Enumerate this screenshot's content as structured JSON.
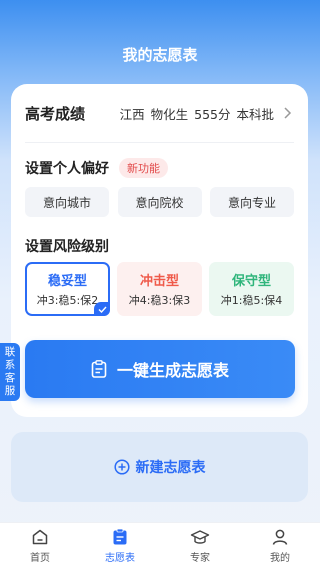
{
  "header": {
    "title": "我的志愿表"
  },
  "score": {
    "title": "高考成绩",
    "province": "江西",
    "subjects": "物化生",
    "points": "555分",
    "batch": "本科批"
  },
  "preferences": {
    "label": "设置个人偏好",
    "badge": "新功能",
    "options": [
      "意向城市",
      "意向院校",
      "意向专业"
    ]
  },
  "risk": {
    "label": "设置风险级别",
    "levels": [
      {
        "name": "稳妥型",
        "ratio": "冲3:稳5:保2",
        "color": "#2b6cf6",
        "selected": true
      },
      {
        "name": "冲击型",
        "ratio": "冲4:稳3:保3",
        "color": "#ef5a4a",
        "selected": false
      },
      {
        "name": "保守型",
        "ratio": "冲1:稳5:保4",
        "color": "#2fb57b",
        "selected": false
      }
    ]
  },
  "generate": {
    "label": "一键生成志愿表"
  },
  "side_contact": {
    "label": "联系客服"
  },
  "new_table": {
    "label": "新建志愿表"
  },
  "tabbar": {
    "items": [
      {
        "label": "首页",
        "icon": "home-icon",
        "active": false
      },
      {
        "label": "志愿表",
        "icon": "clipboard-icon",
        "active": true
      },
      {
        "label": "专家",
        "icon": "graduation-cap-icon",
        "active": false
      },
      {
        "label": "我的",
        "icon": "user-icon",
        "active": false
      }
    ]
  }
}
